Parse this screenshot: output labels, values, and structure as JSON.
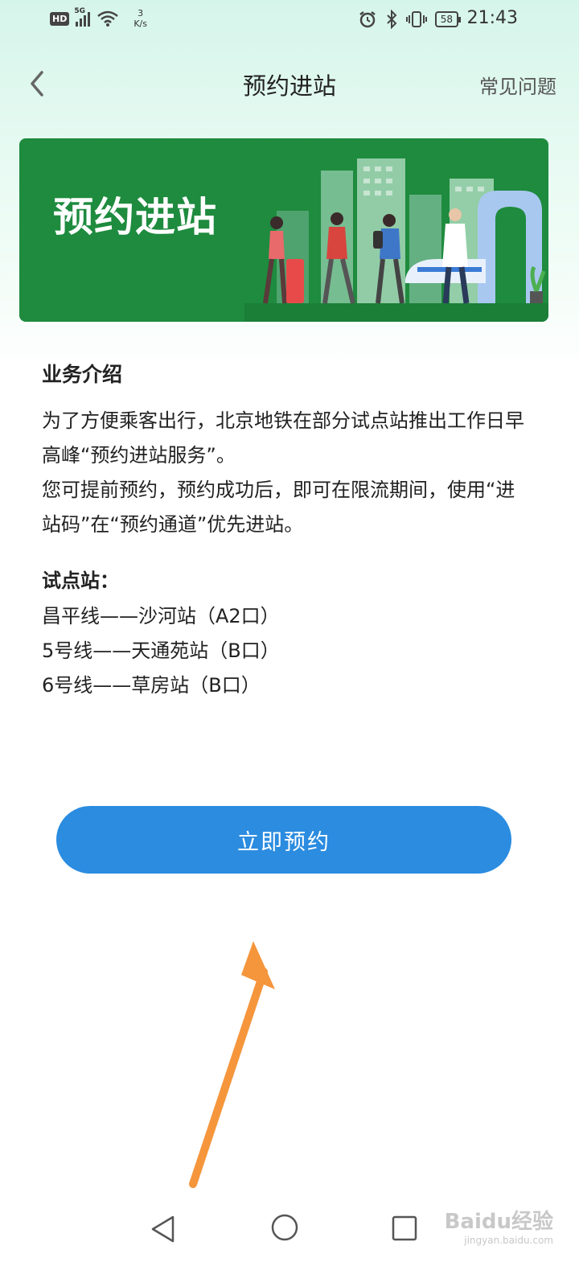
{
  "status_bar": {
    "network_badge": "HD",
    "network_type": "5G",
    "speed_value": "3",
    "speed_unit": "K/s",
    "battery": "58",
    "time": "21:43"
  },
  "nav": {
    "title": "预约进站",
    "faq_label": "常见问题"
  },
  "banner": {
    "title": "预约进站"
  },
  "intro": {
    "heading": "业务介绍",
    "paragraph1": "为了方便乘客出行，北京地铁在部分试点站推出工作日早高峰“预约进站服务”。",
    "paragraph2": "您可提前预约，预约成功后，即可在限流期间，使用“进站码”在“预约通道”优先进站。"
  },
  "pilot": {
    "heading": "试点站：",
    "stations": [
      "昌平线——沙河站（A2口）",
      "5号线——天通苑站（B口）",
      "6号线——草房站（B口）"
    ]
  },
  "action": {
    "reserve_label": "立即预约"
  },
  "watermark": {
    "main": "Baidu经验",
    "sub": "jingyan.baidu.com"
  },
  "colors": {
    "banner_green": "#1e8b3e",
    "button_blue": "#2b8ce0",
    "arrow_orange": "#f5953c"
  }
}
